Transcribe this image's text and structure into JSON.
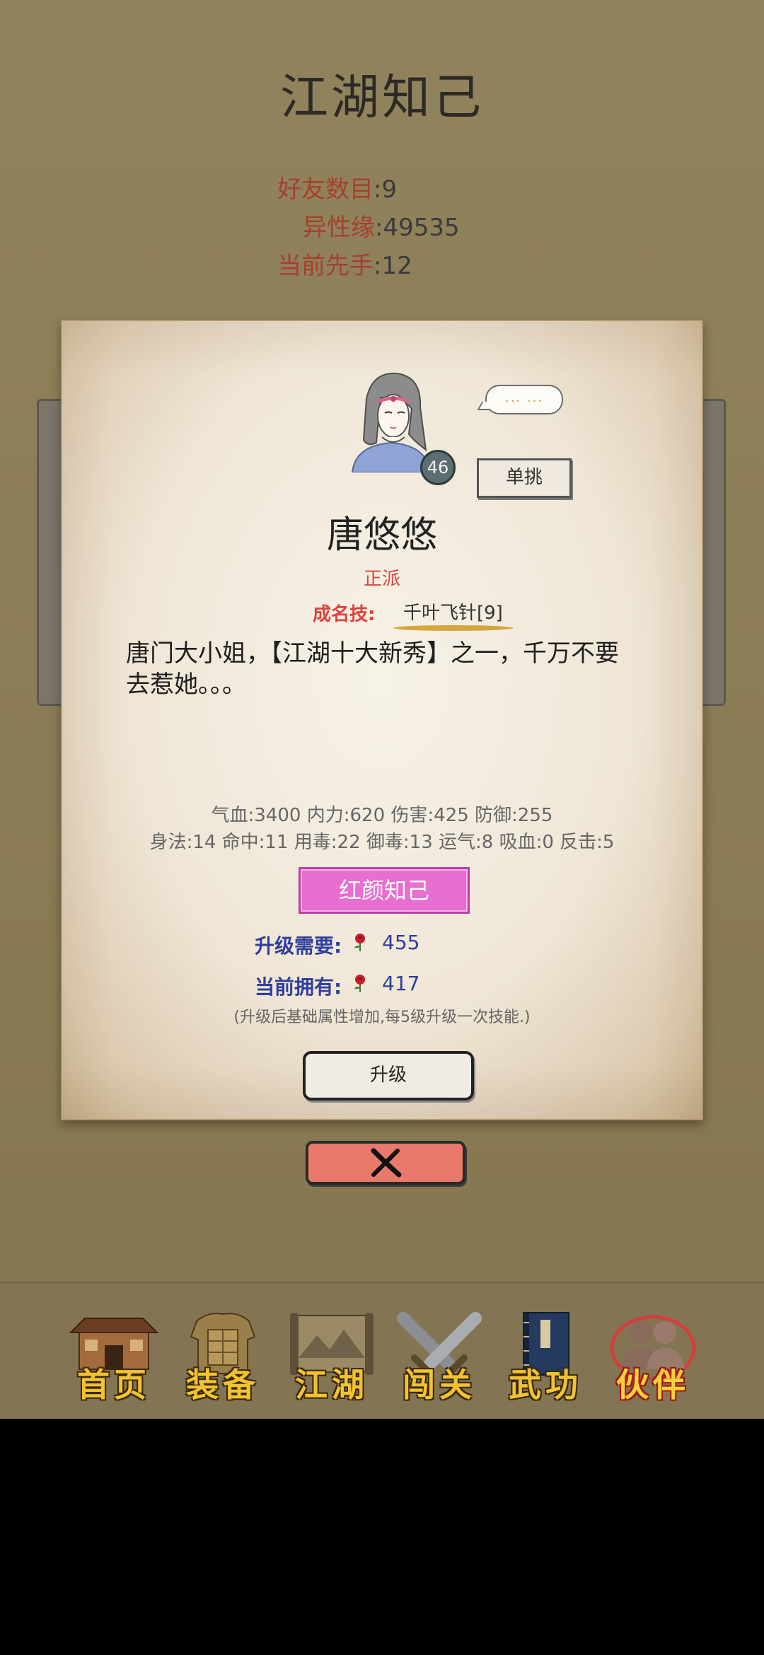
{
  "page": {
    "title": "江湖知己"
  },
  "stats": [
    {
      "key": "好友数目",
      "value": "9"
    },
    {
      "key": "异性缘",
      "value": "49535"
    },
    {
      "key": "当前先手",
      "value": "12"
    }
  ],
  "character": {
    "level": "46",
    "speech_bubble": "... ...",
    "duel_label": "单挑",
    "name": "唐悠悠",
    "faction": "正派",
    "signature_skill_label": "成名技:",
    "signature_skill": "千叶飞针[9]",
    "description": "唐门大小姐，【江湖十大新秀】之一，千万不要去惹她。。。",
    "attributes_line1": "气血:3400  内力:620  伤害:425  防御:255",
    "attributes_line2": "身法:14  命中:11  用毒:22  御毒:13  运气:8  吸血:0  反击:5",
    "title_badge": "红颜知己"
  },
  "upgrade": {
    "required_label": "升级需要:",
    "required_value": "455",
    "owned_label": "当前拥有:",
    "owned_value": "417",
    "hint": "(升级后基础属性增加,每5级升级一次技能.)",
    "button_label": "升级"
  },
  "colors": {
    "background": "#8a7b52",
    "accent_red": "#e0413b",
    "title_badge_pink": "#e86ed0",
    "close_button": "#e9796b",
    "nav_gold": "#f1c232"
  },
  "bottom_nav": [
    {
      "label": "首页",
      "icon": "home-icon"
    },
    {
      "label": "装备",
      "icon": "armor-icon"
    },
    {
      "label": "江湖",
      "icon": "scroll-map-icon"
    },
    {
      "label": "闯关",
      "icon": "crossed-swords-icon"
    },
    {
      "label": "武功",
      "icon": "martial-book-icon"
    },
    {
      "label": "伙伴",
      "icon": "companions-icon",
      "active": true
    }
  ]
}
